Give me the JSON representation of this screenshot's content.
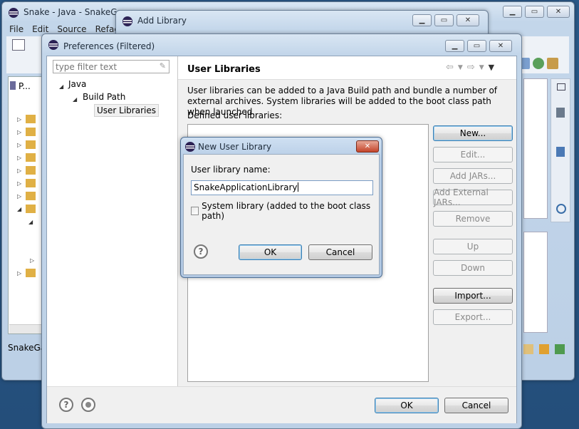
{
  "eclipse": {
    "title": "Snake - Java - SnakeGam",
    "menu": [
      "File",
      "Edit",
      "Source",
      "Refac"
    ],
    "package_tab": "P...",
    "status_text": "SnakeGar"
  },
  "add_library": {
    "title": "Add Library"
  },
  "preferences": {
    "title": "Preferences (Filtered)",
    "filter_placeholder": "type filter text",
    "tree": {
      "java": "Java",
      "build_path": "Build Path",
      "user_libraries": "User Libraries"
    },
    "page_title": "User Libraries",
    "description": "User libraries can be added to a Java Build path and bundle a number of external archives. System libraries will be added to the boot class path when launched.",
    "defined_label": "Defined user libraries:",
    "buttons": {
      "new": "New...",
      "edit": "Edit...",
      "add_jars": "Add JARs...",
      "add_external_jars": "Add External JARs...",
      "remove": "Remove",
      "up": "Up",
      "down": "Down",
      "import": "Import...",
      "export": "Export..."
    },
    "ok": "OK",
    "cancel": "Cancel"
  },
  "new_user_library": {
    "title": "New User Library",
    "name_label": "User library name:",
    "name_value": "SnakeApplicationLibrary",
    "system_checkbox_label": "System library (added to the boot class path)",
    "system_checked": false,
    "ok": "OK",
    "cancel": "Cancel"
  },
  "colors": {
    "accent": "#3c7fb1",
    "desktop": "#2a5a8a"
  }
}
